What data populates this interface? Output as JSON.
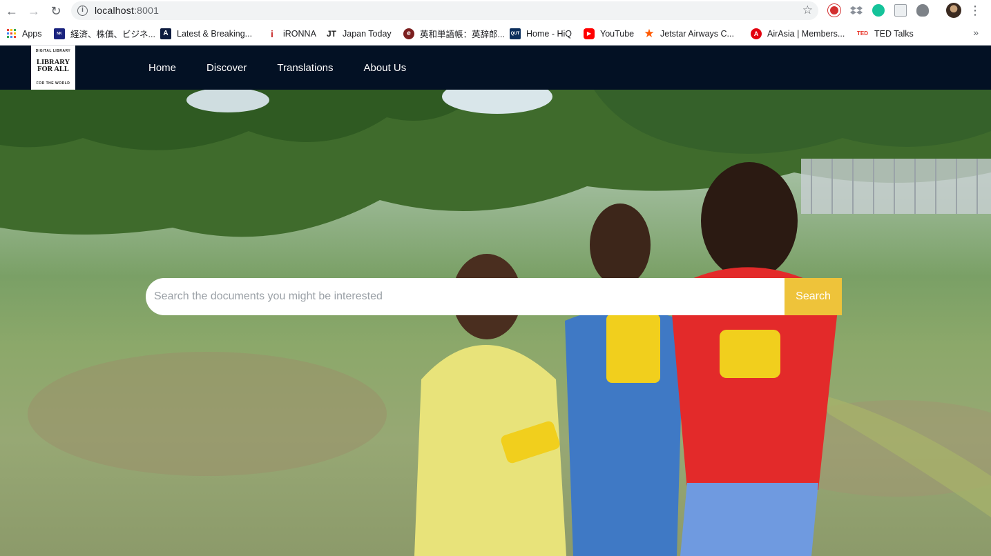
{
  "browser": {
    "url_host": "localhost",
    "url_port": ":8001",
    "bookmarks": [
      {
        "label": "Apps",
        "icon": "apps-grid-icon"
      },
      {
        "label": "経済、株価、ビジネ...",
        "icon": "nikkei-icon",
        "color": "#1a237e"
      },
      {
        "label": "Latest & Breaking...",
        "icon": "atlantic-icon",
        "color": "#0d1b3e"
      },
      {
        "label": "iRONNA",
        "icon": "ironna-icon",
        "color": "#c62828"
      },
      {
        "label": "Japan Today",
        "icon": "japan-today-icon",
        "color": "#222222"
      },
      {
        "label": "英和単語帳：英辞郎...",
        "icon": "eijiro-icon",
        "color": "#7b1f1f"
      },
      {
        "label": "Home - HiQ",
        "icon": "qut-icon",
        "color": "#0b2e5c"
      },
      {
        "label": "YouTube",
        "icon": "youtube-icon",
        "color": "#ff0000"
      },
      {
        "label": "Jetstar Airways C...",
        "icon": "jetstar-star-icon",
        "color": "#ff5a00"
      },
      {
        "label": "AirAsia | Members...",
        "icon": "airasia-icon",
        "color": "#e3000f"
      },
      {
        "label": "TED Talks",
        "icon": "ted-icon",
        "color": "#e62b1e"
      }
    ]
  },
  "site": {
    "logo": {
      "top_text": "DIGITAL LIBRARY",
      "main_line1": "LIBRARY",
      "main_line2": "FOR ALL",
      "bottom_text": "FOR THE WORLD"
    },
    "nav": {
      "home": "Home",
      "discover": "Discover",
      "translations": "Translations",
      "about": "About Us"
    },
    "colors": {
      "navbar_bg": "#031124",
      "accent": "#eec33a"
    }
  },
  "search": {
    "placeholder": "Search the documents you might be interested",
    "value": "",
    "button_label": "Search"
  }
}
